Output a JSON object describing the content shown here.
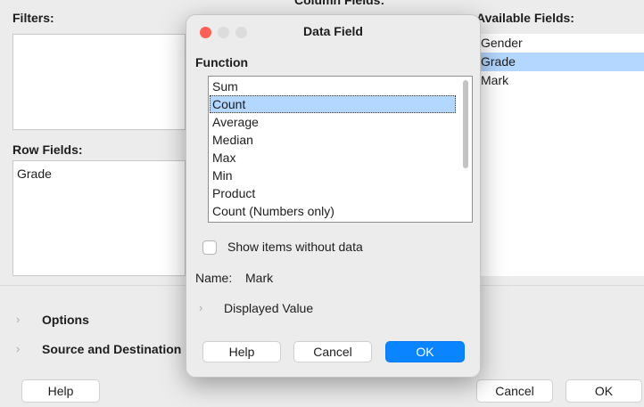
{
  "background": {
    "filters_label": "Filters:",
    "column_fields_label": "Column Fields:",
    "available_fields_label": "Available Fields:",
    "row_fields_label": "Row Fields:",
    "row_fields": [
      "Grade"
    ],
    "available_fields": [
      {
        "label": "Gender",
        "selected": false
      },
      {
        "label": "Grade",
        "selected": true
      },
      {
        "label": "Mark",
        "selected": false
      }
    ],
    "options_label": "Options",
    "source_destination_label": "Source and Destination",
    "help_label": "Help",
    "cancel_label": "Cancel",
    "ok_label": "OK"
  },
  "dialog": {
    "title": "Data Field",
    "function_label": "Function",
    "functions": [
      {
        "label": "Sum",
        "selected": false
      },
      {
        "label": "Count",
        "selected": true
      },
      {
        "label": "Average",
        "selected": false
      },
      {
        "label": "Median",
        "selected": false
      },
      {
        "label": "Max",
        "selected": false
      },
      {
        "label": "Min",
        "selected": false
      },
      {
        "label": "Product",
        "selected": false
      },
      {
        "label": "Count (Numbers only)",
        "selected": false
      }
    ],
    "show_items_label": "Show items without data",
    "show_items_checked": false,
    "name_label": "Name:",
    "name_value": "Mark",
    "displayed_value_label": "Displayed Value",
    "help_label": "Help",
    "cancel_label": "Cancel",
    "ok_label": "OK"
  },
  "colors": {
    "selection": "#b3d7ff",
    "accent": "#0a84ff",
    "close": "#fe5f57",
    "inactive_light": "#dcdcdc"
  },
  "icons": {
    "chevron": "chevron-right-icon",
    "close": "close-window-icon"
  }
}
